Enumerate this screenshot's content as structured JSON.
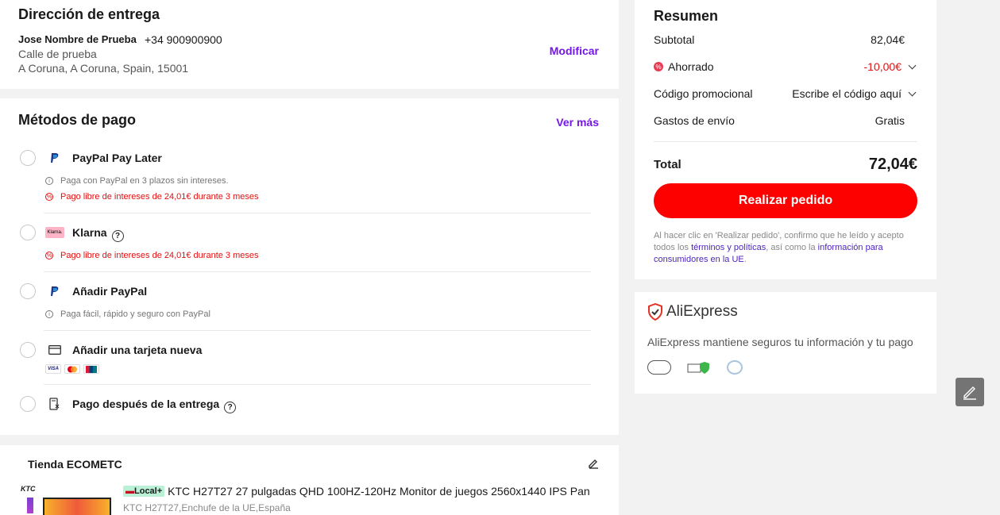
{
  "address": {
    "title": "Dirección de entrega",
    "name": "Jose Nombre de Prueba",
    "phone": "+34 900900900",
    "line1": "Calle de prueba",
    "line2": "A Coruna, A Coruna, Spain, 15001",
    "modify_label": "Modificar"
  },
  "payment": {
    "title": "Métodos de pago",
    "see_more": "Ver más",
    "methods": [
      {
        "label": "PayPal Pay Later",
        "note1": "Paga con PayPal en 3 plazos sin intereses.",
        "note2": "Pago libre de intereses de 24,01€ durante 3 meses"
      },
      {
        "label": "Klarna",
        "logo_text": "Klarna.",
        "note1": "Pago libre de intereses de 24,01€ durante 3 meses"
      },
      {
        "label": "Añadir PayPal",
        "note1": "Paga fácil, rápido y seguro con PayPal"
      },
      {
        "label": "Añadir una tarjeta nueva",
        "card_logos": [
          "VISA",
          "mastercard",
          "unionpay"
        ]
      },
      {
        "label": "Pago después de la entrega"
      }
    ]
  },
  "store": {
    "title": "Tienda ECOMETC",
    "product_badge": "Local+",
    "product_title": "KTC H27T27 27 pulgadas QHD 100HZ-120Hz Monitor de juegos 2560x1440 IPS Pan",
    "product_sub": "KTC H27T27,Enchufe de la UE,España",
    "brand_thumb": "KTC"
  },
  "summary": {
    "title": "Resumen",
    "subtotal_label": "Subtotal",
    "subtotal_value": "82,04€",
    "saved_label": "Ahorrado",
    "saved_value": "-10,00€",
    "promo_label": "Código promocional",
    "promo_value": "Escribe el código aquí",
    "shipping_label": "Gastos de envío",
    "shipping_value": "Gratis",
    "total_label": "Total",
    "total_value": "72,04€",
    "order_button": "Realizar pedido",
    "legal_a": "Al hacer clic en 'Realizar pedido', confirmo que he leído y acepto todos los ",
    "legal_link1": "términos y políticas",
    "legal_b": ", así como la ",
    "legal_link2": "información para consumidores en la UE",
    "legal_c": "."
  },
  "secure": {
    "brand": "AliExpress",
    "text": "AliExpress mantiene seguros tu información y tu pago"
  },
  "colors": {
    "accent_purple": "#7416e6",
    "primary_red": "#fd0000",
    "discount_red": "#e50f0f",
    "link_blue": "#4b1fc1"
  }
}
